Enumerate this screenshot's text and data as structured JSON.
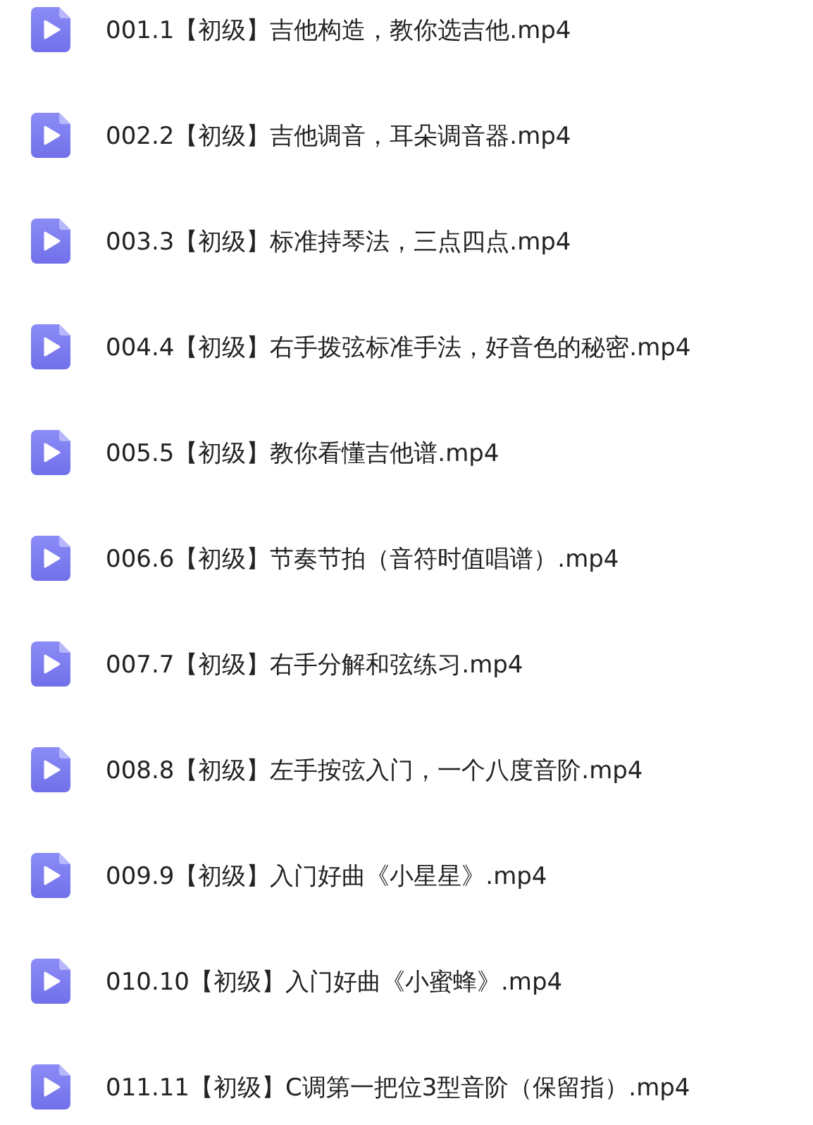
{
  "files": [
    {
      "name": "001.1【初级】吉他构造，教你选吉他.mp4"
    },
    {
      "name": "002.2【初级】吉他调音，耳朵调音器.mp4"
    },
    {
      "name": "003.3【初级】标准持琴法，三点四点.mp4"
    },
    {
      "name": "004.4【初级】右手拨弦标准手法，好音色的秘密.mp4"
    },
    {
      "name": "005.5【初级】教你看懂吉他谱.mp4"
    },
    {
      "name": "006.6【初级】节奏节拍（音符时值唱谱）.mp4"
    },
    {
      "name": "007.7【初级】右手分解和弦练习.mp4"
    },
    {
      "name": "008.8【初级】左手按弦入门，一个八度音阶.mp4"
    },
    {
      "name": "009.9【初级】入门好曲《小星星》.mp4"
    },
    {
      "name": "010.10【初级】入门好曲《小蜜蜂》.mp4"
    },
    {
      "name": "011.11【初级】C调第一把位3型音阶（保留指）.mp4"
    }
  ]
}
